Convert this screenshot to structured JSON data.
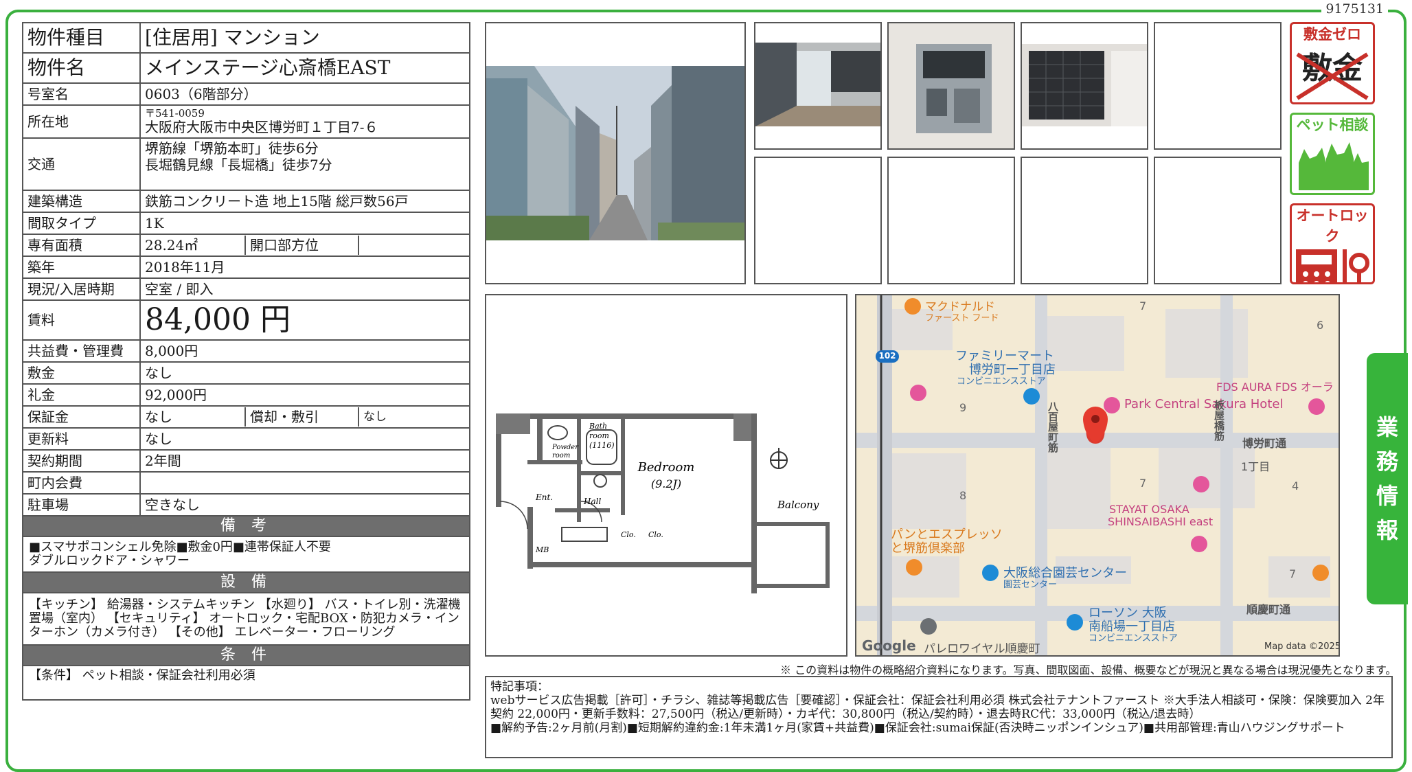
{
  "doc_id": "9175131",
  "spec": {
    "type_label": "物件種目",
    "type_value": "[住居用] マンション",
    "name_label": "物件名",
    "name_value": "メインステージ心斎橋EAST",
    "room_label": "号室名",
    "room_value": "0603（6階部分）",
    "address_label": "所在地",
    "postal": "〒541-0059",
    "address_value": "大阪府大阪市中央区博労町１丁目7-６",
    "transit_label": "交通",
    "transit_1": "堺筋線「堺筋本町」徒歩6分",
    "transit_2": "長堀鶴見線「長堀橋」徒歩7分",
    "structure_label": "建築構造",
    "structure_value": "鉄筋コンクリート造 地上15階 総戸数56戸",
    "layout_label": "間取タイプ",
    "layout_value": "1K",
    "area_label": "専有面積",
    "area_value": "28.24㎡",
    "direction_label": "開口部方位",
    "direction_value": "",
    "built_label": "築年",
    "built_value": "2018年11月",
    "status_label": "現況/入居時期",
    "status_value": "空室 / 即入",
    "rent_label": "賃料",
    "rent_value": "84,000 円",
    "fee_label": "共益費・管理費",
    "fee_value": "8,000円",
    "deposit_label": "敷金",
    "deposit_value": "なし",
    "key_money_label": "礼金",
    "key_money_value": "92,000円",
    "guarantee_label": "保証金",
    "guarantee_value": "なし",
    "amort_label": "償却・敷引",
    "amort_value": "なし",
    "renewal_label": "更新料",
    "renewal_value": "なし",
    "contract_label": "契約期間",
    "contract_value": "2年間",
    "town_fee_label": "町内会費",
    "town_fee_value": "",
    "parking_label": "駐車場",
    "parking_value": "空きなし"
  },
  "sections": {
    "remarks_title": "備 考",
    "remarks_body_1": "■スマサポコンシェル免除■敷金0円■連帯保証人不要",
    "remarks_body_2": "ダブルロックドア・シャワー",
    "facilities_title": "設 備",
    "facilities_body": "【キッチン】 給湯器・システムキッチン 【水廻り】 バス・トイレ別・洗濯機置場（室内） 【セキュリティ】 オートロック・宅配BOX・防犯カメラ・インターホン（カメラ付き） 【その他】 エレベーター・フローリング",
    "conditions_title": "条 件",
    "conditions_body": "【条件】 ペット相談・保証会社利用必須"
  },
  "badges": {
    "zero_deposit": "敷金ゼロ",
    "zero_deposit_strike": "敷金",
    "pet": "ペット相談",
    "autolock": "オートロック"
  },
  "floorplan": {
    "bedroom": "Bedroom",
    "bedroom_size": "(9.2J)",
    "bath": "Bath",
    "bath_room": "room",
    "bath_size": "(1116)",
    "powder": "Powder",
    "powder_room": "room",
    "ent": "Ent.",
    "hall": "Hall",
    "mb": "MB",
    "clo1": "Clo.",
    "clo2": "Clo.",
    "balcony": "Balcony"
  },
  "map": {
    "mcd": "マクドナルド",
    "mcd_sub": "ファースト フード",
    "family1": "ファミリーマート",
    "family2": "博労町一丁目店",
    "family3": "コンビニエンスストア",
    "hotel": "Park Central Sakura Hotel",
    "fds": "FDS AURA FDS オーラ",
    "street1": "博労町通",
    "street2": "八百屋町筋",
    "street3": "板屋橋筋",
    "street4": "順慶町通",
    "chome": "1丁目",
    "stayat1": "STAYAT OSAKA",
    "stayat2": "SHINSAIBASHI east",
    "pan1": "パンとエスプレッソ",
    "pan2": "と堺筋倶楽部",
    "garden1": "大阪総合園芸センター",
    "garden2": "園芸センター",
    "lawson1": "ローソン 大阪",
    "lawson2": "南船場一丁目店",
    "lawson3": "コンビニエンスストア",
    "palais": "パレロワイヤル順慶町",
    "route": "102",
    "n7a": "7",
    "n6": "6",
    "n9": "9",
    "n8": "8",
    "n7b": "7",
    "n4": "4",
    "n7c": "7",
    "google": "Google",
    "copyright": "Map data ©2025"
  },
  "notes": {
    "disclaimer": "※ この資料は物件の概略紹介資料になります。写真、間取図面、設備、概要などが現況と異なる場合は現況優先となります。",
    "title": "特記事項：",
    "line1": "webサービス広告掲載［許可］・チラシ、雑誌等掲載広告［要確認］・保証会社：保証会社利用必須 株式会社テナントファースト ※大手法人相談可・保険：保険要加入 2年契約 22,000円・更新手数料：27,500円（税込/更新時）・カギ代：30,800円（税込/契約時）・退去時RC代：33,000円（税込/退去時）",
    "line2": "■解約予告:2ヶ月前(月割)■短期解約違約金:1年未満1ヶ月(家賃+共益費)■保証会社:sumai保証(否決時ニッポンインシュア)■共用部管理:青山ハウジングサポート"
  },
  "side_tab": [
    "業",
    "務",
    "情",
    "報"
  ],
  "colors": {
    "frame": "#3ab03e",
    "section_head": "#6e6e6e",
    "badge_red": "#c8302a",
    "badge_green": "#55b83a"
  }
}
